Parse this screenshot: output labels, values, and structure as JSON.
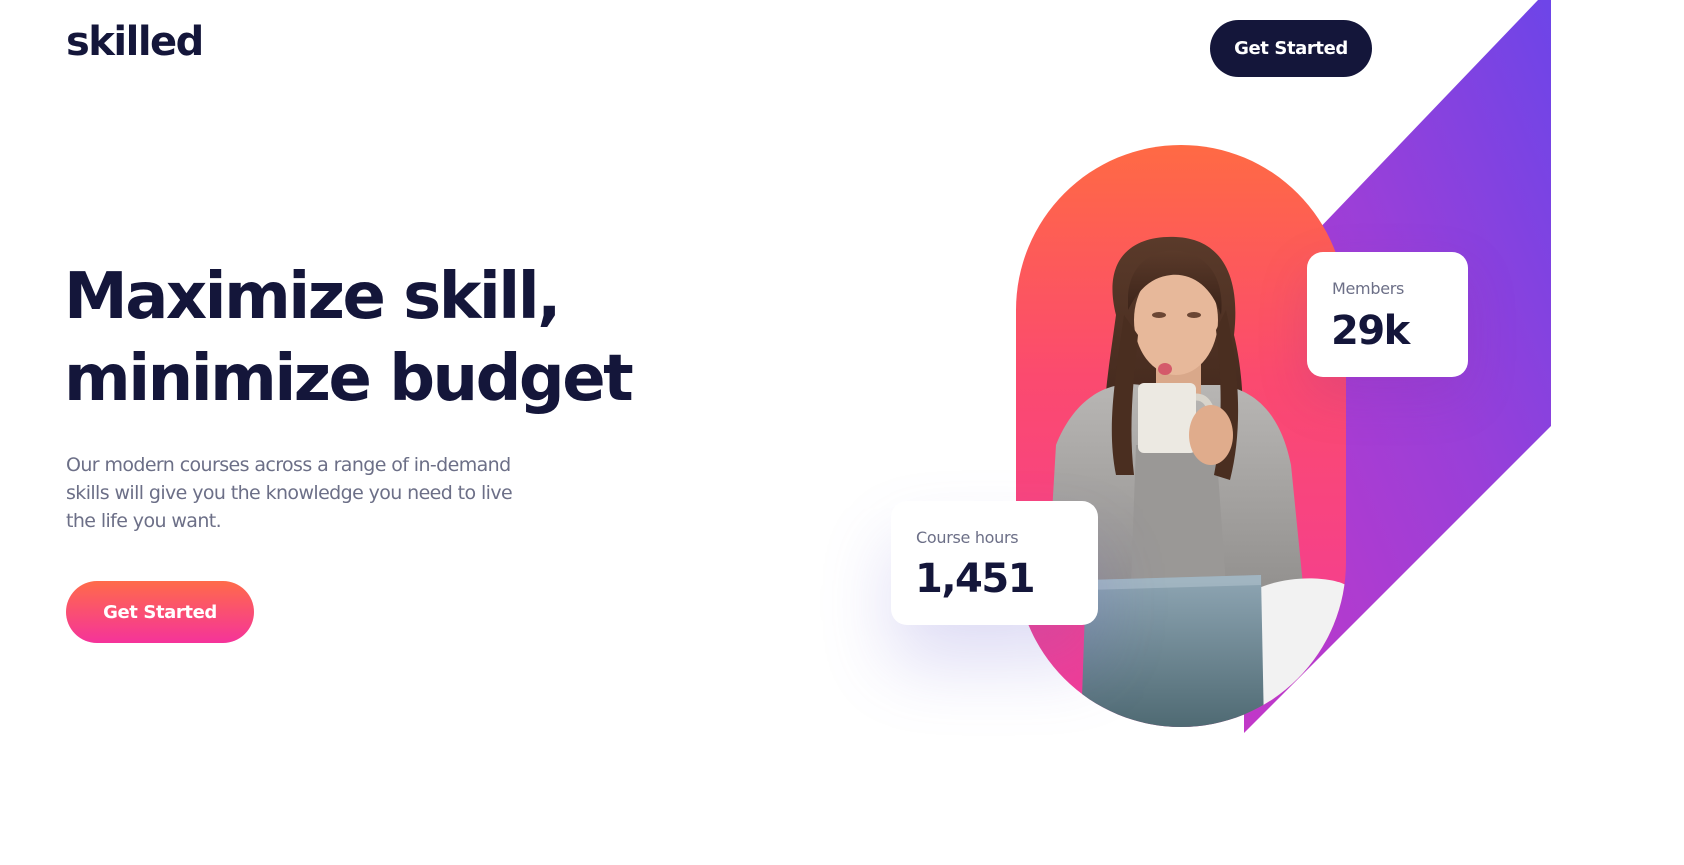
{
  "header": {
    "logo": "skilled",
    "cta_label": "Get Started"
  },
  "hero": {
    "title_line1": "Maximize skill,",
    "title_line2": "minimize budget",
    "description": "Our modern courses across a range of in-demand skills will give you the knowledge you need to live the life you want.",
    "cta_label": "Get Started"
  },
  "stats": {
    "members": {
      "label": "Members",
      "value": "29k"
    },
    "course_hours": {
      "label": "Course hours",
      "value": "1,451"
    }
  },
  "colors": {
    "navy": "#14163a",
    "muted_text": "#6c6f87",
    "orange": "#ff6b4a",
    "pink": "#f5339a",
    "violet": "#6d45e8",
    "purple": "#c238c8"
  },
  "illustration": {
    "photo": "woman-with-coffee-mug-and-laptop"
  }
}
